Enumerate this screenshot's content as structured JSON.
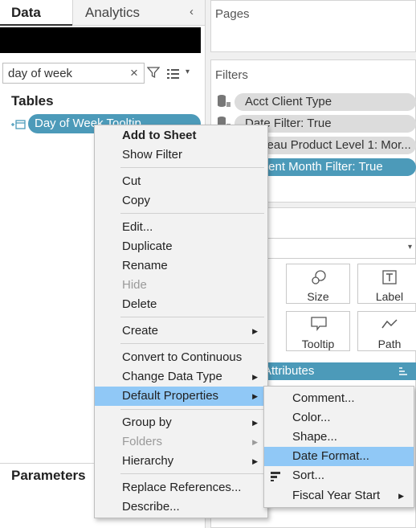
{
  "tabs": {
    "data": "Data",
    "analytics": "Analytics",
    "collapse": "‹"
  },
  "search": {
    "value": "day of week",
    "clear": "×"
  },
  "view_caret": "▾",
  "tables_heading": "Tables",
  "field_pill": "Day of Week Tooltip",
  "parameters_heading": "Parameters",
  "pages_title": "Pages",
  "filters_title": "Filters",
  "filters": [
    {
      "label": "Acct Client Type"
    },
    {
      "label": "Date Filter: True"
    },
    {
      "label": "Tableau Product Level 1: Mor..."
    },
    {
      "label": "Current Month Filter: True"
    }
  ],
  "marks": {
    "dropdown_caret": "▾",
    "buttons": [
      {
        "label": "Size",
        "icon": "size-icon"
      },
      {
        "label": "Label",
        "icon": "label-icon"
      },
      {
        "label": "Tooltip",
        "icon": "tooltip-icon"
      },
      {
        "label": "Path",
        "icon": "path-icon"
      }
    ],
    "attributes_pill": "Attributes"
  },
  "context_menu": {
    "items": [
      {
        "label": "Add to Sheet",
        "bold": true
      },
      {
        "label": "Show Filter"
      },
      {
        "label": "Cut"
      },
      {
        "label": "Copy"
      },
      {
        "label": "Edit..."
      },
      {
        "label": "Duplicate"
      },
      {
        "label": "Rename"
      },
      {
        "label": "Hide",
        "disabled": true
      },
      {
        "label": "Delete"
      },
      {
        "label": "Create",
        "submenu": true
      },
      {
        "label": "Convert to Continuous"
      },
      {
        "label": "Change Data Type",
        "submenu": true
      },
      {
        "label": "Default Properties",
        "submenu": true,
        "highlighted": true
      },
      {
        "label": "Group by",
        "submenu": true
      },
      {
        "label": "Folders",
        "submenu": true,
        "disabled": true
      },
      {
        "label": "Hierarchy",
        "submenu": true
      },
      {
        "label": "Replace References..."
      },
      {
        "label": "Describe..."
      }
    ],
    "arrow": "▶"
  },
  "submenu": {
    "items": [
      {
        "label": "Comment..."
      },
      {
        "label": "Color..."
      },
      {
        "label": "Shape..."
      },
      {
        "label": "Date Format...",
        "highlighted": true
      },
      {
        "label": "Sort..."
      },
      {
        "label": "Fiscal Year Start"
      }
    ],
    "arrow": "▶"
  },
  "colors": {
    "pill_blue": "#4c9ab9",
    "menu_highlight": "#90c8f6"
  }
}
